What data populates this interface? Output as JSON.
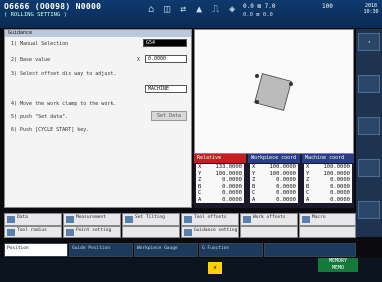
{
  "header": {
    "program": "O6666 (O0098)  N0000",
    "subtitle": "( ROLLING SETTING )",
    "status_a": "0.0  ⊠ 7.0",
    "status_b": "0.0   ⊠ 0.0",
    "feed": "100",
    "clock": "2018 10:30"
  },
  "panel": {
    "title": "Guidance",
    "steps": [
      "1) Manual Selection",
      "2) Base value",
      "3) Select offset dis way to adjust.",
      "4) Move the work clamp to the work.",
      "5) push \"Set data\".",
      "6) Push [CYCLE START] key."
    ],
    "field_select": "G54",
    "base_axis": "X",
    "base_value": "0.0000",
    "field_dir": "MACHINE",
    "set_data": "Set Data"
  },
  "coords": {
    "relative_label": "Relative",
    "workpiece_label": "Workpiece coord",
    "machine_label": "Machine coord",
    "axes": [
      "X",
      "Y",
      "Z",
      "B",
      "C",
      "A"
    ],
    "relative": [
      "133.0000",
      "100.0000",
      "0.0000",
      "0.0000",
      "0.0000",
      "0.0000"
    ],
    "workpiece": [
      "100.0000",
      "100.0000",
      "0.0000",
      "0.0000",
      "0.0000",
      "0.0000"
    ],
    "machine": [
      "100.0000",
      "100.0000",
      "0.0000",
      "0.0000",
      "0.0000",
      "0.0000"
    ]
  },
  "softkeys": {
    "row1": [
      "Data",
      "Measurement",
      "Set Tilting",
      "Tool offsets",
      "Work offsets",
      "Macro"
    ],
    "row2": [
      "Tool radius",
      "Point setting",
      "",
      "Guidance setting",
      "",
      ""
    ]
  },
  "tabs": [
    "Position",
    "Guide Position",
    "Workpiece Gauge",
    "G Function",
    ""
  ],
  "bottom": {
    "memory": "MEMORY",
    "mode": "MEMO"
  }
}
